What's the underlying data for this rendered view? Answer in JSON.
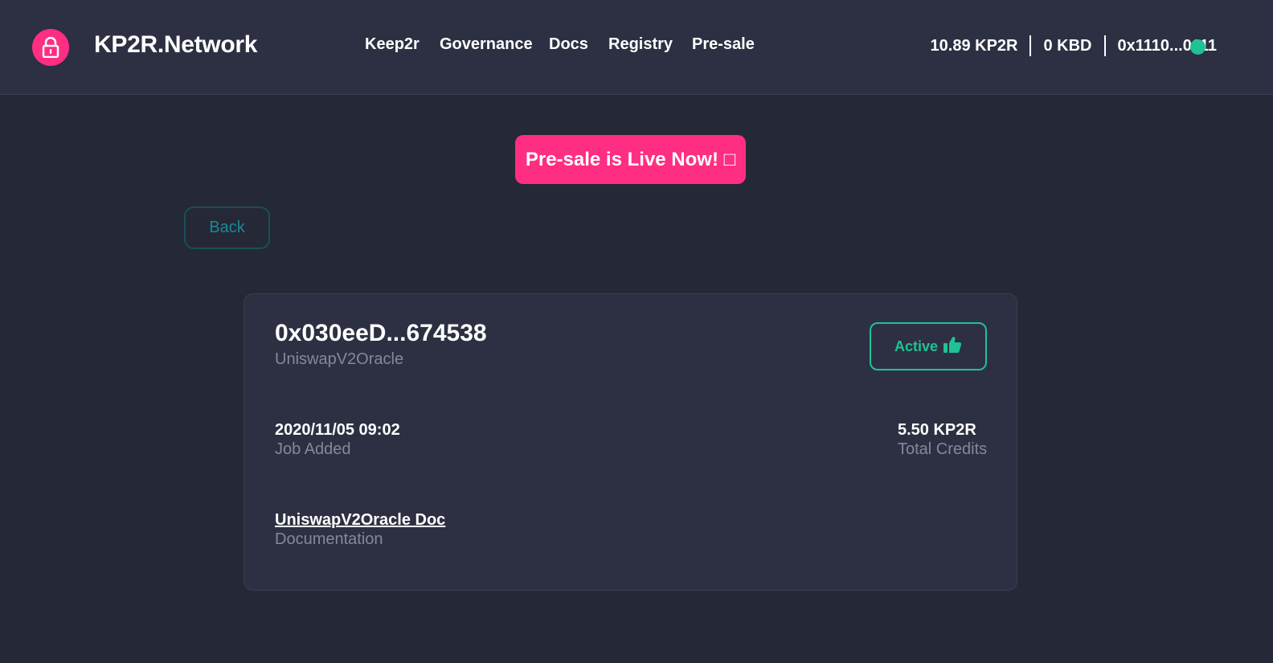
{
  "header": {
    "brand": "KP2R.Network",
    "nav": [
      {
        "label": "Keep2r"
      },
      {
        "label": "Governance"
      },
      {
        "label": "Docs"
      },
      {
        "label": "Registry"
      },
      {
        "label": "Pre-sale"
      }
    ],
    "account": {
      "kp2r_balance": "10.89 KP2R",
      "kbd_balance": "0 KBD",
      "address": "0x1110...0111"
    },
    "icons": {
      "logo": "lock-icon",
      "status": "connected-dot-icon"
    }
  },
  "presale_button": "Pre-sale is Live Now! □",
  "back_button": "Back",
  "job": {
    "address": "0x030eeD...674538",
    "name": "UniswapV2Oracle",
    "status_label": "Active",
    "status_icon": "thumbs-up-icon",
    "added_value": "2020/11/05 09:02",
    "added_label": "Job Added",
    "credits_value": "5.50 KP2R",
    "credits_label": "Total Credits",
    "doc_link": "UniswapV2Oracle Doc",
    "doc_label": "Documentation"
  },
  "colors": {
    "background": "#252836",
    "panel": "#2d3042",
    "accent_pink": "#ff2e83",
    "accent_green": "#1fc294",
    "accent_teal": "#168b98",
    "muted_text": "#85889a"
  }
}
